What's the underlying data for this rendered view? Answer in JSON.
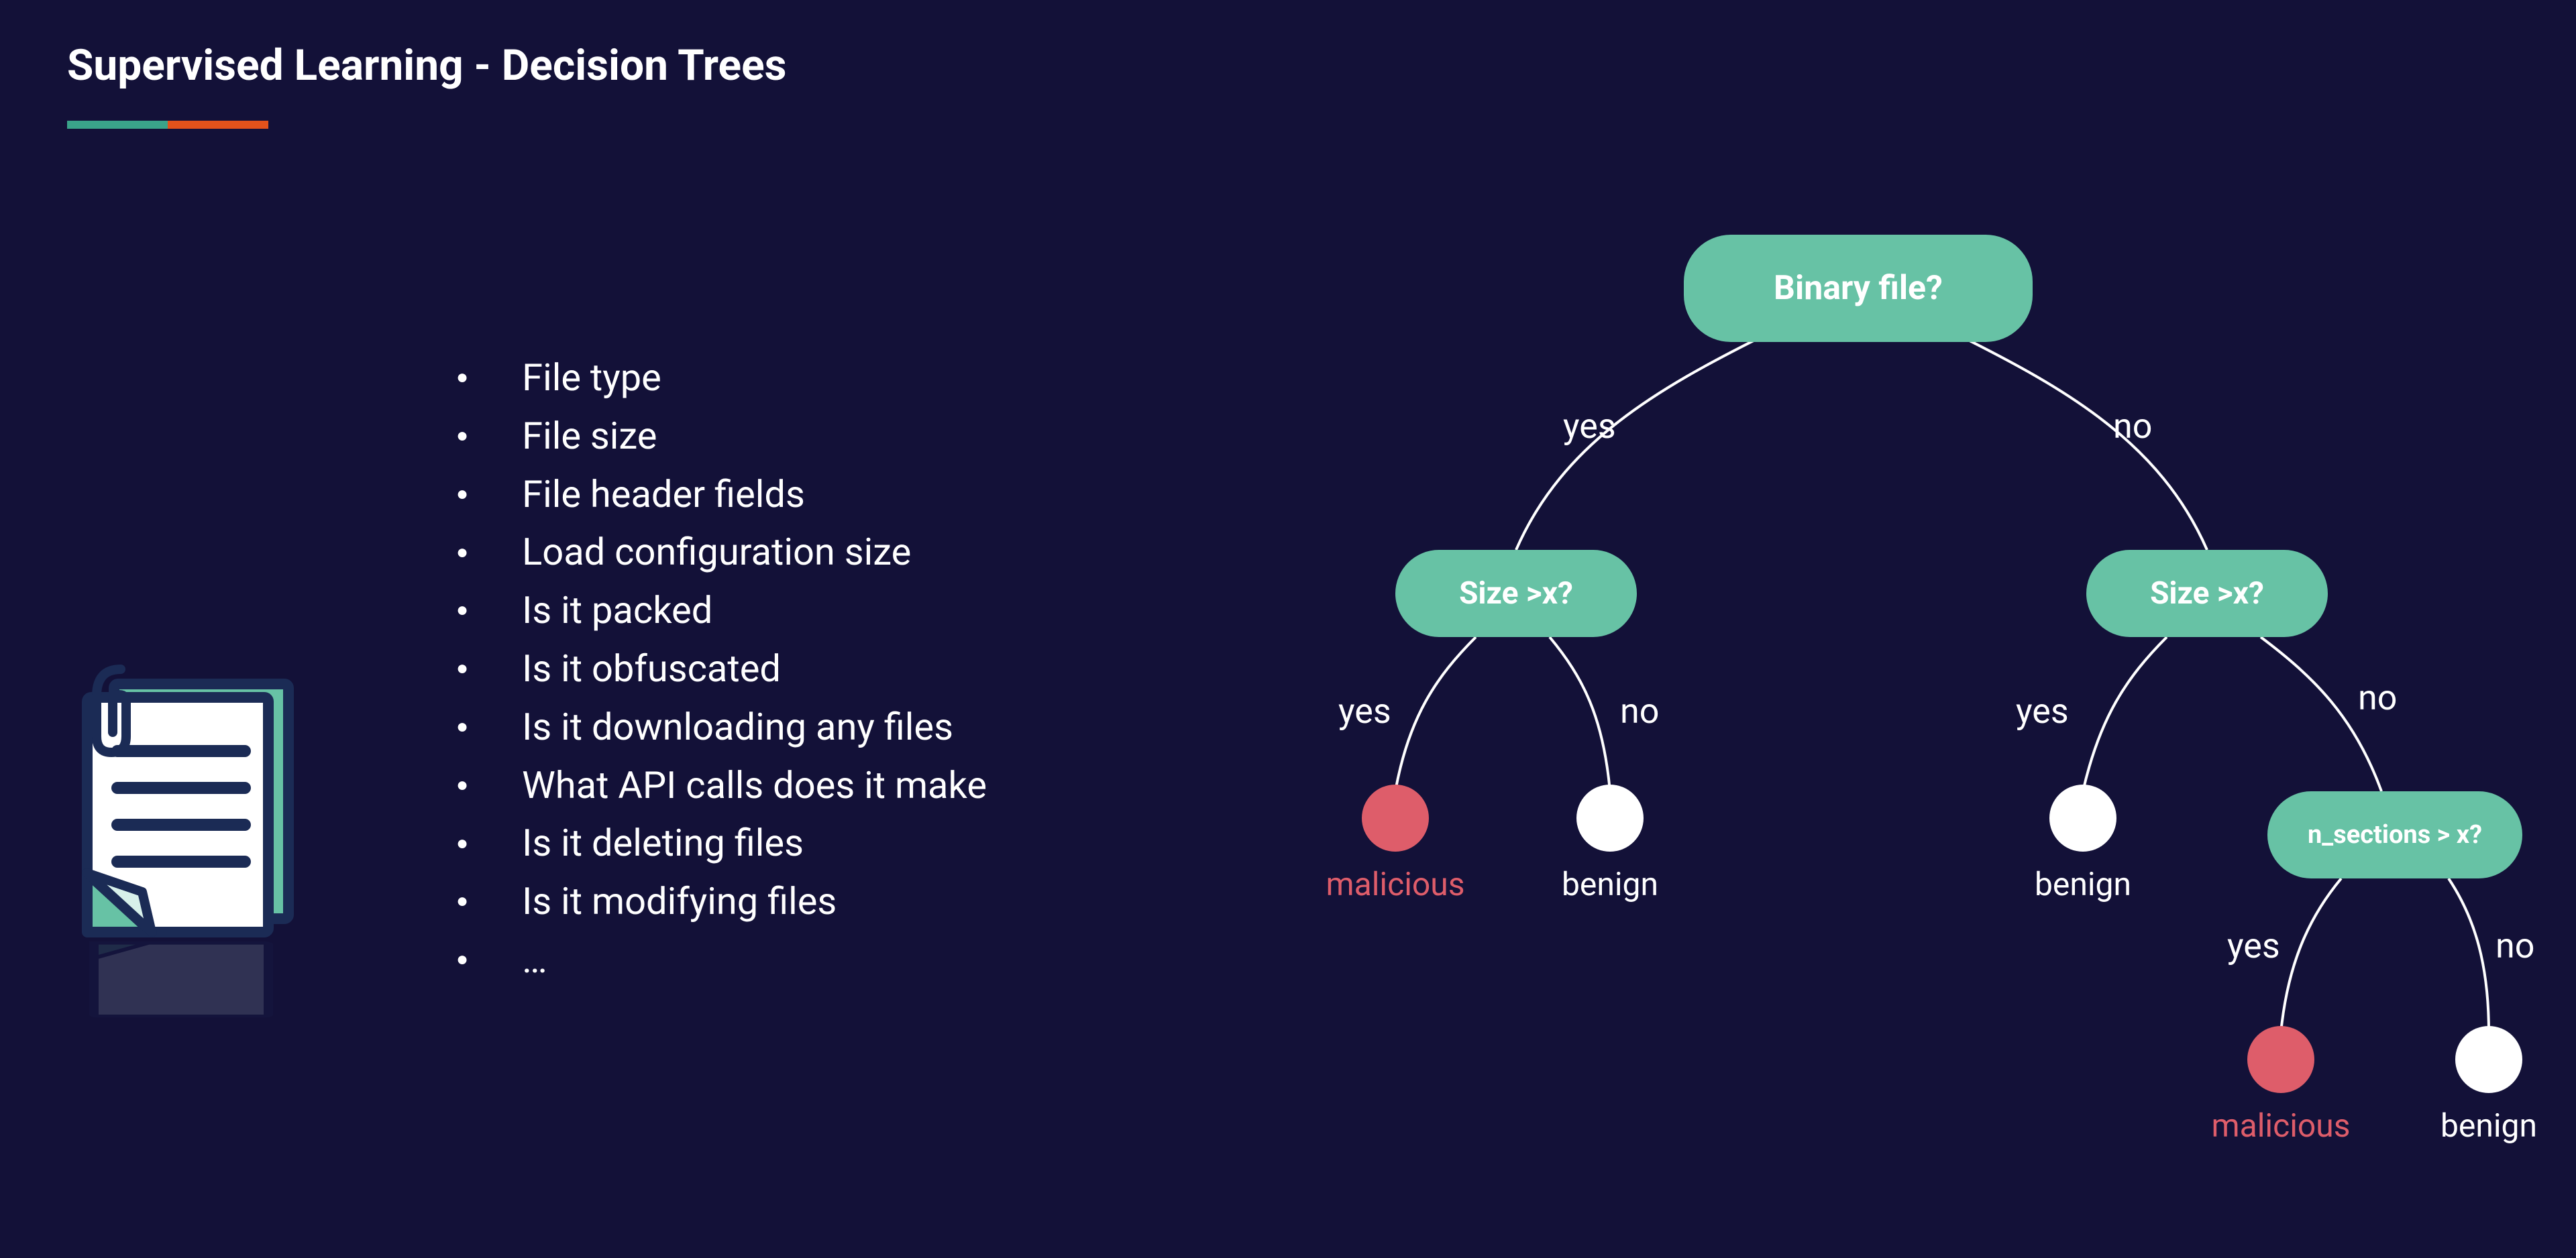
{
  "title": "Supervised Learning - Decision Trees",
  "colors": {
    "background": "#131138",
    "teal": "#67c2a5",
    "teal_dark": "#3aa38a",
    "orange": "#e2521b",
    "red": "#de5d6a",
    "white": "#ffffff",
    "navy": "#1b2b55"
  },
  "features": [
    "File type",
    "File size",
    "File header fields",
    "Load configuration size",
    "Is it packed",
    "Is it obfuscated",
    "Is it downloading any files",
    "What API calls does it make",
    "Is it deleting files",
    "Is it modifying files",
    "…"
  ],
  "tree": {
    "root": {
      "label": "Binary file?"
    },
    "edges": {
      "yes": "yes",
      "no": "no"
    },
    "left": {
      "label": "Size >x?",
      "yes": {
        "leaf": "malicious"
      },
      "no": {
        "leaf": "benign"
      }
    },
    "right": {
      "label": "Size >x?",
      "yes": {
        "leaf": "benign"
      },
      "no": {
        "label": "n_sections > x?",
        "yes": {
          "leaf": "malicious"
        },
        "no": {
          "leaf": "benign"
        }
      }
    }
  }
}
